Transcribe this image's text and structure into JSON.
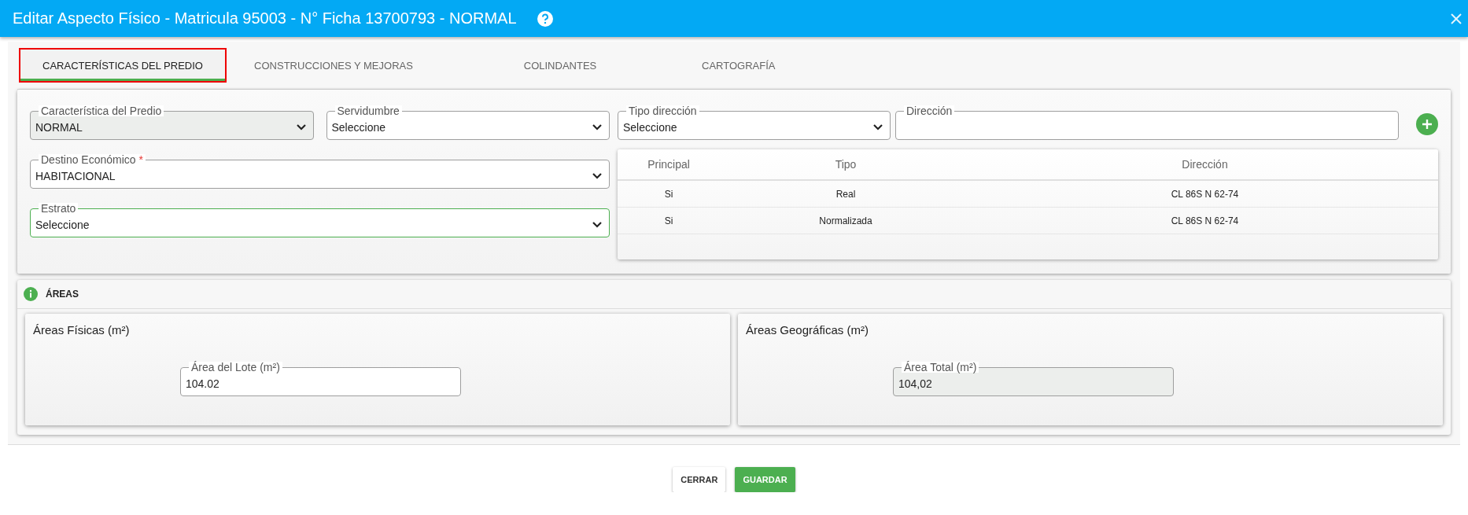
{
  "window": {
    "title": "Editar Aspecto Físico - Matricula 95003 - N° Ficha 13700793 - NORMAL"
  },
  "tabs": [
    {
      "label": "CARACTERÍSTICAS DEL PREDIO",
      "selected": true
    },
    {
      "label": "CONSTRUCCIONES Y MEJORAS",
      "selected": false
    },
    {
      "label": "COLINDANTES",
      "selected": false
    },
    {
      "label": "CARTOGRAFÍA",
      "selected": false
    }
  ],
  "fields": [
    {
      "kind": "select",
      "label": "Característica del Predio",
      "value": "NORMAL",
      "disabled": true,
      "focused": false
    },
    {
      "kind": "select",
      "label": "Servidumbre",
      "value": "Seleccione",
      "disabled": false,
      "focused": false
    },
    {
      "kind": "select",
      "label": "Destino Económico",
      "required_mark": "*",
      "value": "HABITACIONAL",
      "disabled": false,
      "focused": false
    },
    {
      "kind": "select",
      "label": "Estrato",
      "value": "Seleccione",
      "disabled": false,
      "focused": true
    }
  ],
  "address_fields": [
    {
      "kind": "select",
      "label": "Tipo dirección",
      "value": "Seleccione",
      "disabled": false,
      "focused": false
    },
    {
      "kind": "input",
      "label": "Dirección",
      "disabled": false,
      "focused": false
    }
  ],
  "address_table": {
    "columns": [
      "Principal",
      "Tipo",
      "Dirección"
    ],
    "rows": [
      [
        "Si",
        "Real",
        "CL 86S N 62-74"
      ],
      [
        "Si",
        "Normalizada",
        "CL 86S N 62-74"
      ]
    ]
  },
  "areas": {
    "title": "ÁREAS",
    "cards": [
      {
        "title": "Áreas Físicas (m²)",
        "field": {
          "kind": "input",
          "label": "Área del Lote (m²)",
          "value": "104.02",
          "disabled": false,
          "focused": false
        }
      },
      {
        "title": "Áreas Geográficas (m²)",
        "field": {
          "kind": "input",
          "label": "Área Total (m²)",
          "value": "104,02",
          "disabled": true,
          "focused": false
        }
      }
    ]
  },
  "buttons": [
    {
      "kind": "secondary",
      "label": "CERRAR"
    },
    {
      "kind": "primary",
      "label": "GUARDAR"
    }
  ]
}
